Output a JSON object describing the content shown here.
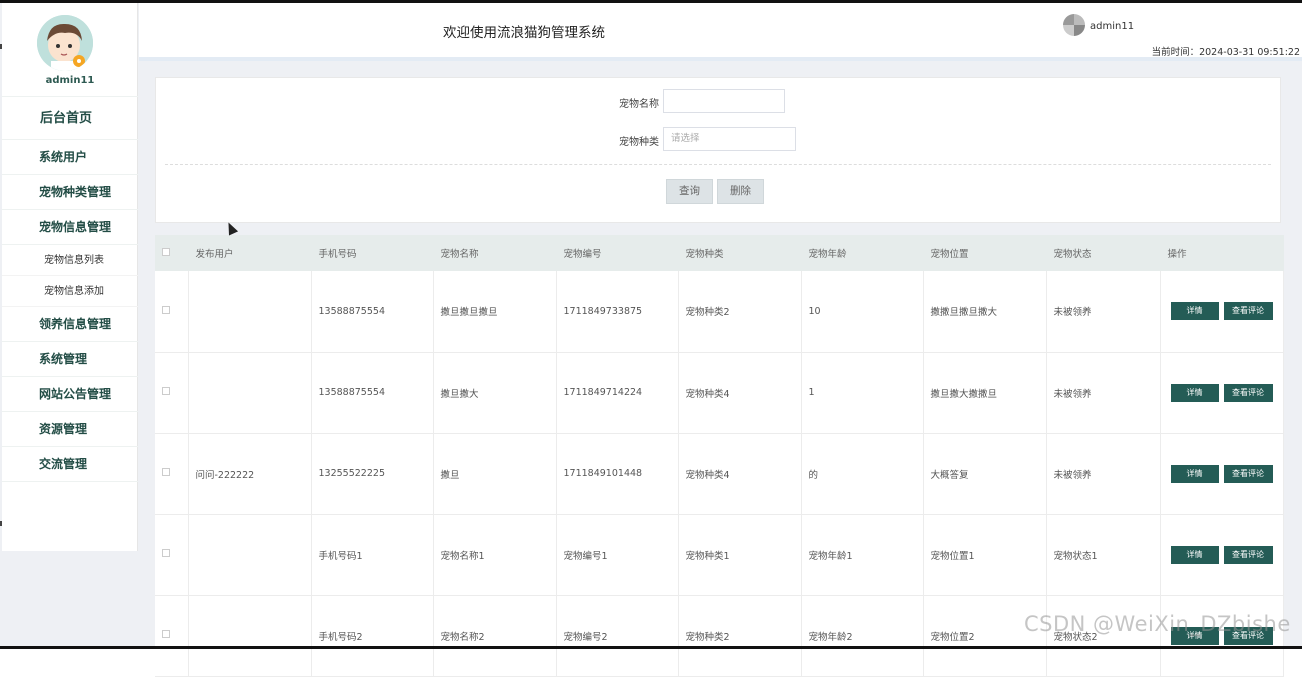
{
  "sidebar": {
    "username": "admin11",
    "menu": [
      {
        "label": "后台首页"
      },
      {
        "label": "系统用户"
      },
      {
        "label": "宠物种类管理"
      },
      {
        "label": "宠物信息管理",
        "children": [
          {
            "label": "宠物信息列表"
          },
          {
            "label": "宠物信息添加"
          }
        ]
      },
      {
        "label": "领养信息管理"
      },
      {
        "label": "系统管理"
      },
      {
        "label": "网站公告管理"
      },
      {
        "label": "资源管理"
      },
      {
        "label": "交流管理"
      }
    ]
  },
  "header": {
    "title": "欢迎使用流浪猫狗管理系统",
    "username": "admin11",
    "time_label": "当前时间：",
    "time_value": "2024-03-31 09:51:22"
  },
  "search": {
    "name_label": "宠物名称",
    "name_value": "",
    "type_label": "宠物种类",
    "type_placeholder": "请选择",
    "query_button": "查询",
    "delete_button": "删除"
  },
  "table": {
    "columns": [
      "发布用户",
      "手机号码",
      "宠物名称",
      "宠物编号",
      "宠物种类",
      "宠物年龄",
      "宠物位置",
      "宠物状态",
      "操作"
    ],
    "detail_label": "详情",
    "comment_label": "查看评论",
    "rows": [
      [
        "",
        "13588875554",
        "撒旦撒旦撒旦",
        "1711849733875",
        "宠物种类2",
        "10",
        "撒撒旦撒旦撒大",
        "未被领养"
      ],
      [
        "",
        "13588875554",
        "撒旦撒大",
        "1711849714224",
        "宠物种类4",
        "1",
        "撒旦撒大撒撒旦",
        "未被领养"
      ],
      [
        "问问-222222",
        "13255522225",
        "撒旦",
        "1711849101448",
        "宠物种类4",
        "的",
        "大概答复",
        "未被领养"
      ],
      [
        "",
        "手机号码1",
        "宠物名称1",
        "宠物编号1",
        "宠物种类1",
        "宠物年龄1",
        "宠物位置1",
        "宠物状态1"
      ],
      [
        "",
        "手机号码2",
        "宠物名称2",
        "宠物编号2",
        "宠物种类2",
        "宠物年龄2",
        "宠物位置2",
        "宠物状态2"
      ]
    ]
  },
  "watermark": "CSDN @WeiXin_DZbishe"
}
